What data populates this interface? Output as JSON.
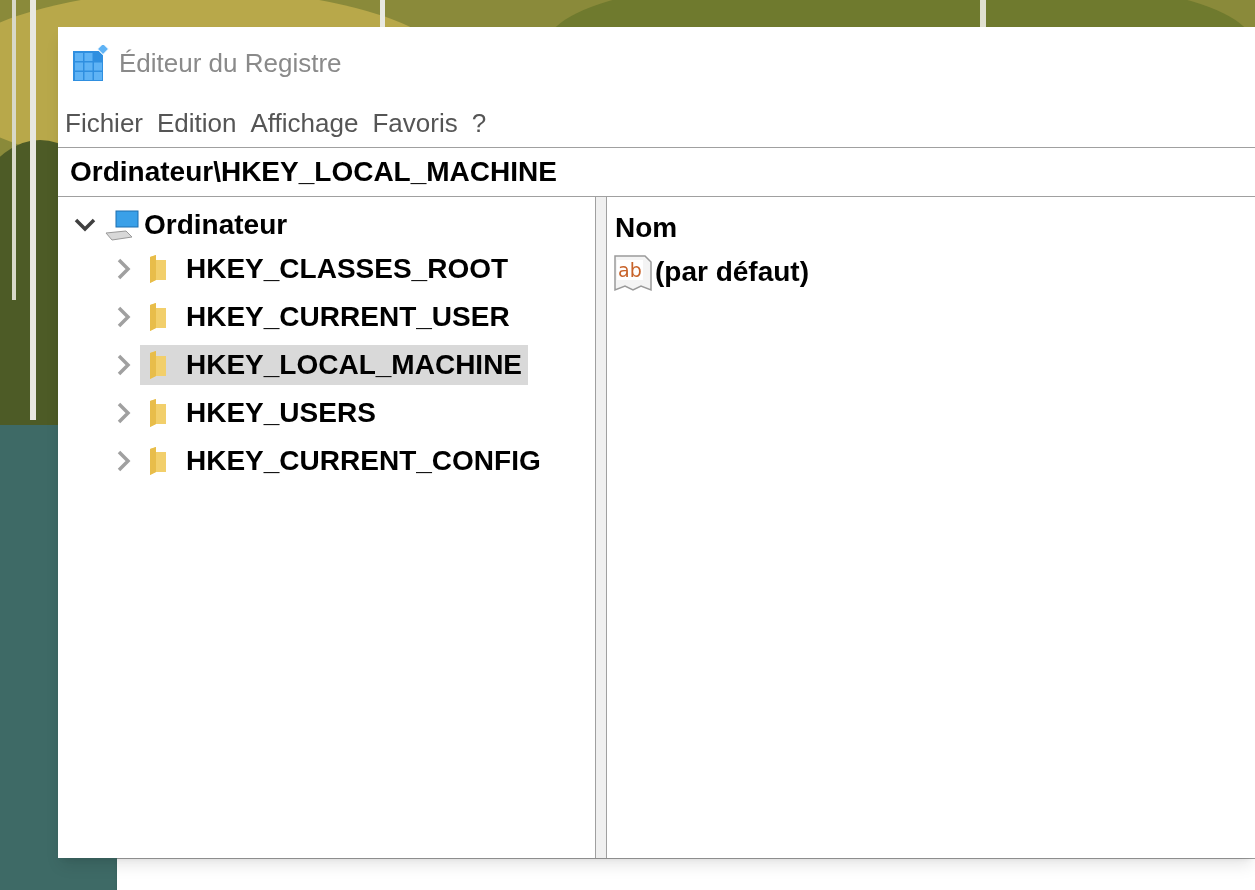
{
  "window": {
    "title": "Éditeur du Registre"
  },
  "menu": [
    "Fichier",
    "Edition",
    "Affichage",
    "Favoris",
    "?"
  ],
  "address": "Ordinateur\\HKEY_LOCAL_MACHINE",
  "tree": {
    "label": "Ordinateur",
    "expanded": true,
    "children": [
      {
        "label": "HKEY_CLASSES_ROOT",
        "expanded": false,
        "selected": false
      },
      {
        "label": "HKEY_CURRENT_USER",
        "expanded": false,
        "selected": false
      },
      {
        "label": "HKEY_LOCAL_MACHINE",
        "expanded": false,
        "selected": true
      },
      {
        "label": "HKEY_USERS",
        "expanded": false,
        "selected": false
      },
      {
        "label": "HKEY_CURRENT_CONFIG",
        "expanded": false,
        "selected": false
      }
    ]
  },
  "list": {
    "columns": [
      "Nom"
    ],
    "rows": [
      {
        "icon_text": "ab",
        "name": "(par défaut)"
      }
    ]
  }
}
